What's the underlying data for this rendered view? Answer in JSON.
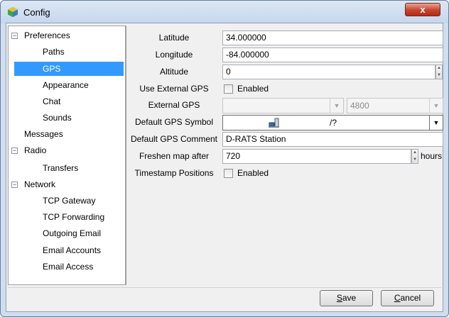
{
  "window": {
    "title": "Config",
    "close_label": "x"
  },
  "tree": {
    "items": [
      {
        "label": "Preferences",
        "expander": "⊟"
      },
      {
        "label": "Paths"
      },
      {
        "label": "GPS"
      },
      {
        "label": "Appearance"
      },
      {
        "label": "Chat"
      },
      {
        "label": "Sounds"
      },
      {
        "label": "Messages"
      },
      {
        "label": "Radio",
        "expander": "⊟"
      },
      {
        "label": "Transfers"
      },
      {
        "label": "Network",
        "expander": "⊟"
      },
      {
        "label": "TCP Gateway"
      },
      {
        "label": "TCP Forwarding"
      },
      {
        "label": "Outgoing Email"
      },
      {
        "label": "Email Accounts"
      },
      {
        "label": "Email Access"
      }
    ],
    "selected": "GPS"
  },
  "gps": {
    "latitude_label": "Latitude",
    "latitude_value": "34.000000",
    "longitude_label": "Longitude",
    "longitude_value": "-84.000000",
    "altitude_label": "Altitude",
    "altitude_value": "0",
    "use_external_label": "Use External GPS",
    "use_external_checkbox_label": "Enabled",
    "external_gps_label": "External GPS",
    "external_gps_port": "",
    "external_gps_baud": "4800",
    "default_symbol_label": "Default GPS Symbol",
    "default_symbol_value": "/?",
    "default_comment_label": "Default GPS Comment",
    "default_comment_value": "D-RATS Station",
    "freshen_label": "Freshen map after",
    "freshen_value": "720",
    "freshen_unit": "hours",
    "timestamp_label": "Timestamp Positions",
    "timestamp_checkbox_label": "Enabled"
  },
  "buttons": {
    "save_mnemonic": "S",
    "save_rest": "ave",
    "cancel_mnemonic": "C",
    "cancel_rest": "ancel"
  },
  "icons": {
    "app": "dice-app-icon",
    "symbol": "computer-symbol-icon"
  },
  "colors": {
    "selection": "#3399ff",
    "close_button": "#c7432c"
  }
}
